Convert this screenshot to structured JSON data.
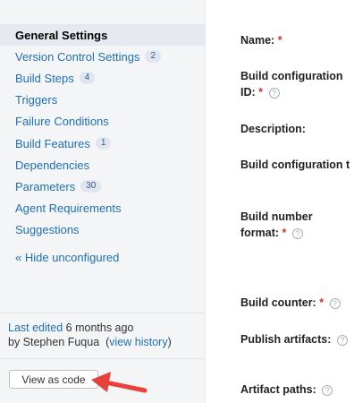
{
  "sidebar": {
    "items": [
      {
        "label": "General Settings",
        "badge": ""
      },
      {
        "label": "Version Control Settings",
        "badge": "2"
      },
      {
        "label": "Build Steps",
        "badge": "4"
      },
      {
        "label": "Triggers",
        "badge": ""
      },
      {
        "label": "Failure Conditions",
        "badge": ""
      },
      {
        "label": "Build Features",
        "badge": "1"
      },
      {
        "label": "Dependencies",
        "badge": ""
      },
      {
        "label": "Parameters",
        "badge": "30"
      },
      {
        "label": "Agent Requirements",
        "badge": ""
      },
      {
        "label": "Suggestions",
        "badge": ""
      }
    ],
    "hide_unconfigured": "« Hide unconfigured",
    "last_edited_prefix": "Last edited",
    "last_edited_time": "6 months ago",
    "by_text": "by Stephen Fuqua",
    "view_history": "view history",
    "view_as_code": "View as code"
  },
  "form": {
    "name_label": "Name:",
    "build_config_id_label_1": "Build configuration",
    "build_config_id_label_2": "ID:",
    "description_label": "Description:",
    "build_config_t_label": "Build configuration t",
    "build_number_label_1": "Build number",
    "build_number_label_2": "format:",
    "build_counter_label": "Build counter:",
    "publish_artifacts_label": "Publish artifacts:",
    "artifact_paths_label": "Artifact paths:",
    "required_mark": "*",
    "help_glyph": "?"
  },
  "colors": {
    "link": "#1f6fb8",
    "required": "#d0312d",
    "arrow": "#e8403a"
  }
}
